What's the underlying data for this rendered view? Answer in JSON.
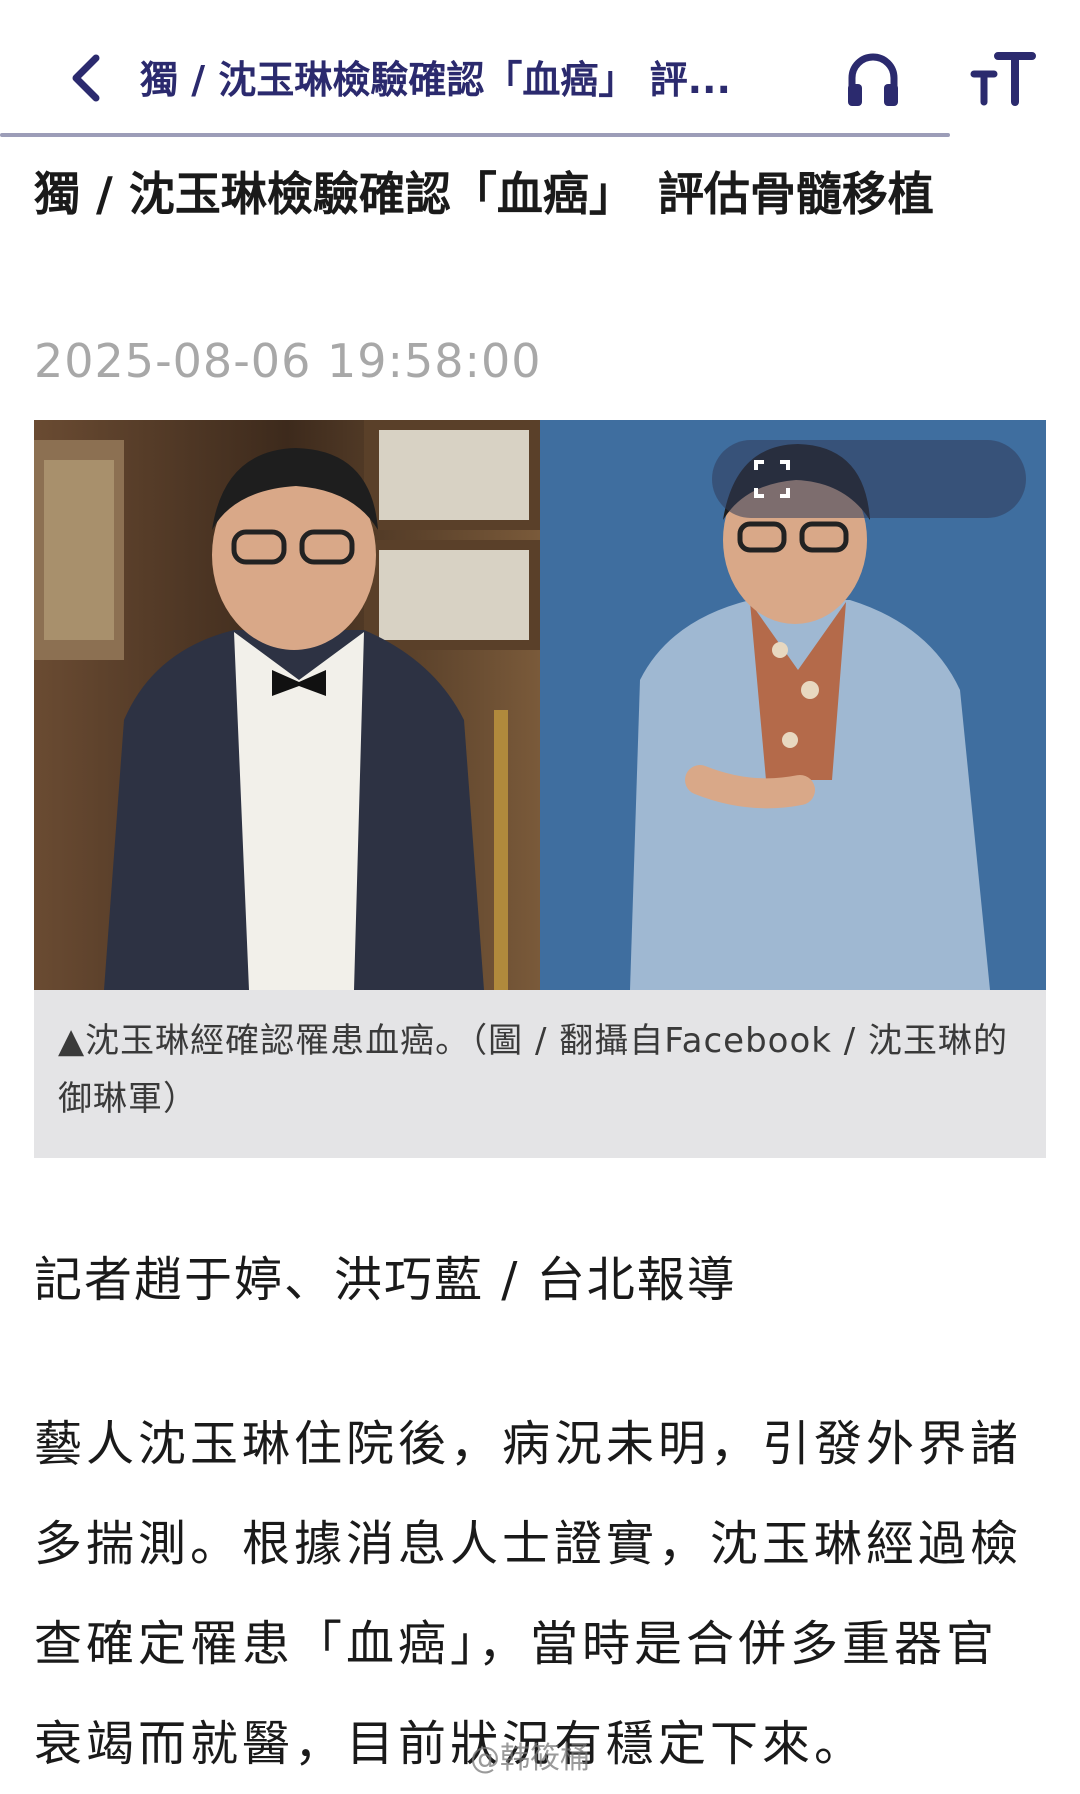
{
  "topbar": {
    "title": "獨 / 沈玉琳檢驗確認「血癌」 評...",
    "back_icon": "chevron-left-icon",
    "audio_icon": "headphones-icon",
    "font_icon": "text-size-icon",
    "accent_color": "#2b2a6e"
  },
  "article": {
    "headline": "獨 / 沈玉琳檢驗確認「血癌」　評估骨髓移植",
    "date": "2025-08-06 19:58:00",
    "caption": "▲沈玉琳經確認罹患血癌。（圖 / 翻攝自Facebook / 沈玉琳的御琳軍）",
    "byline": "記者趙于婷、洪巧藍 / 台北報導",
    "body": "藝人沈玉琳住院後，病況未明，引發外界諸多揣測。根據消息人士證實，沈玉琳經過檢查確定罹患「血癌」，當時是合併多重器官衰竭而就醫，目前狀況有穩定下來。"
  },
  "watermark": "@韩筱桶"
}
